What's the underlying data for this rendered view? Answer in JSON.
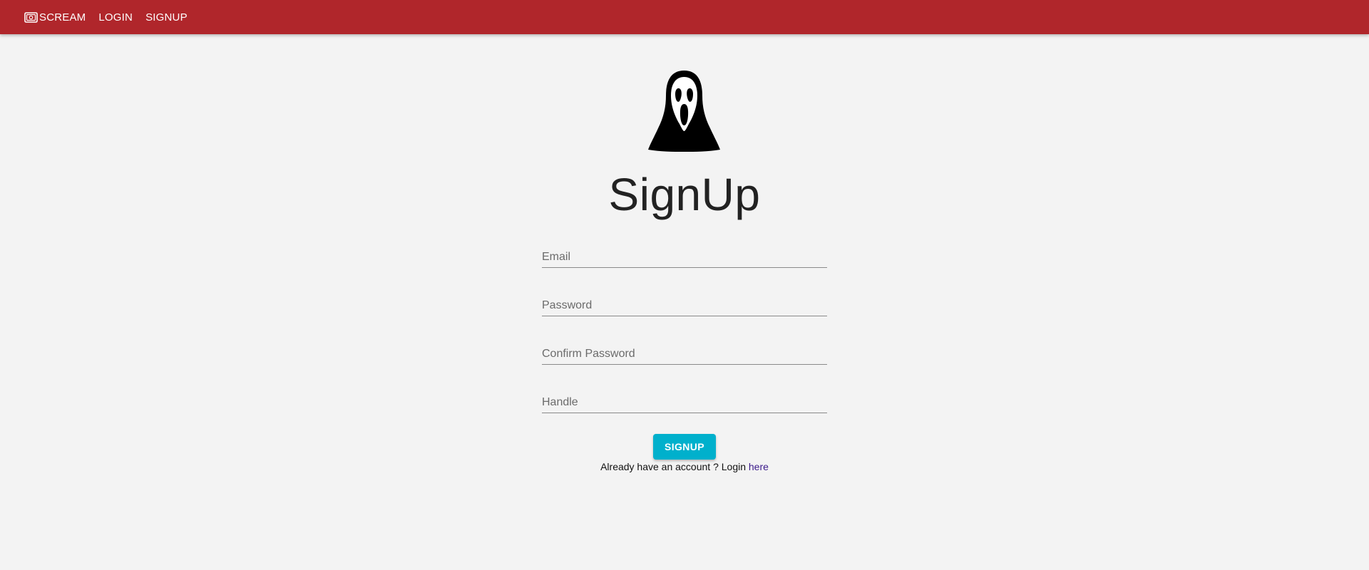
{
  "navbar": {
    "brand_label": "SCREAM",
    "brand_icon": "scream-camera-icon",
    "links": [
      {
        "label": "LOGIN"
      },
      {
        "label": "SIGNUP"
      }
    ],
    "background_color": "#b0262b"
  },
  "main": {
    "logo_icon": "ghostface-logo-icon",
    "title": "SignUp",
    "fields": {
      "email": {
        "placeholder": "Email",
        "value": ""
      },
      "password": {
        "placeholder": "Password",
        "value": ""
      },
      "confirm_password": {
        "placeholder": "Confirm Password",
        "value": ""
      },
      "handle": {
        "placeholder": "Handle",
        "value": ""
      }
    },
    "submit_label": "SIGNUP",
    "submit_color": "#00b0cc",
    "login_prompt": "Already have an account ? Login ",
    "login_link_label": "here"
  }
}
